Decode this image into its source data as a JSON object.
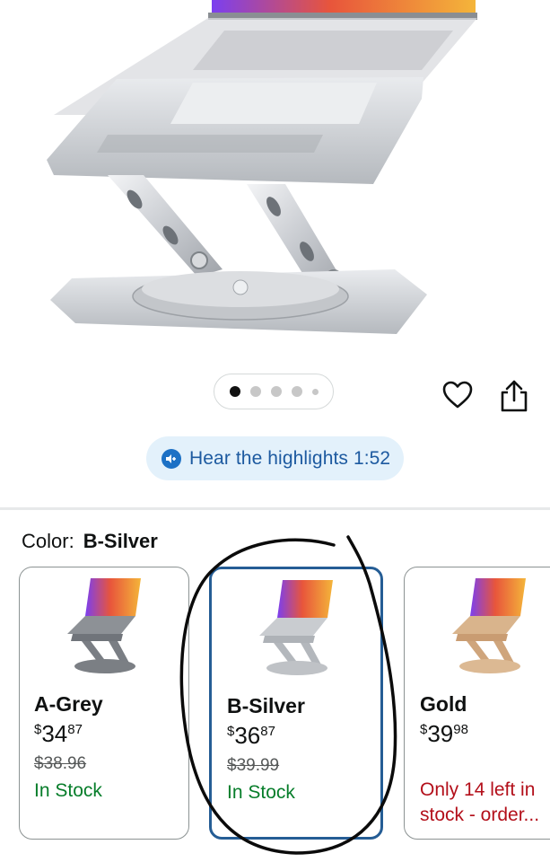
{
  "gallery": {
    "image_count": 5,
    "active_index": 0
  },
  "actions": {
    "wishlist_icon": "heart-icon",
    "share_icon": "share-icon"
  },
  "highlights": {
    "label": "Hear the highlights 1:52",
    "icon": "audio-play-icon"
  },
  "color_selector": {
    "label": "Color:",
    "selected": "B-Silver",
    "options": [
      {
        "name": "A-Grey",
        "currency": "$",
        "whole": "34",
        "cents": "87",
        "list_price": "$38.96",
        "availability": "In Stock",
        "stock_status": "in"
      },
      {
        "name": "B-Silver",
        "currency": "$",
        "whole": "36",
        "cents": "87",
        "list_price": "$39.99",
        "availability": "In Stock",
        "stock_status": "in"
      },
      {
        "name": "Gold",
        "currency": "$",
        "whole": "39",
        "cents": "98",
        "list_price": "",
        "availability": "Only 14 left in stock - order...",
        "stock_status": "low"
      }
    ]
  },
  "colors": {
    "accent_blue": "#1d71c5",
    "selected_border": "#255d95",
    "in_stock_green": "#067d2a",
    "low_stock_red": "#b30f1a",
    "highlight_bg": "#e3f1fb"
  }
}
